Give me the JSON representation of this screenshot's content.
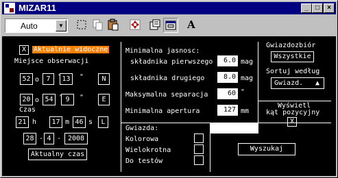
{
  "window": {
    "title": "MIZAR11"
  },
  "titlebar_buttons": {
    "minimize": "_",
    "maximize": "□",
    "close": "×"
  },
  "toolbar": {
    "zoom_value": "Auto",
    "text_tool": "A"
  },
  "observation": {
    "current_checkbox_mark": "X",
    "current_label": "Aktualnie widoczne",
    "place_label": "Miejsce obserwacji",
    "lat": {
      "deg": "52",
      "deg_unit": "o",
      "min": "7",
      "min_unit": "'",
      "sec": "13",
      "sec_unit": "\"",
      "hemisphere": "N"
    },
    "lon": {
      "deg": "20",
      "deg_unit": "o",
      "min": "54",
      "min_unit": "'",
      "sec": "9",
      "sec_unit": "\"",
      "hemisphere": "E"
    },
    "time_label": "Czas",
    "time": {
      "h": "21",
      "h_unit": "h",
      "m": "17",
      "m_unit": "m",
      "s": "46",
      "s_unit": "s",
      "zone": "L"
    },
    "date": {
      "day": "28",
      "sep1": "-",
      "month": "4",
      "sep2": "-",
      "year": "2008"
    },
    "current_time_button": "Aktualny czas"
  },
  "limits": {
    "min_brightness_label": "Minimalna jasnosc:",
    "first_component_label": "składnika pierwszego",
    "first_component_value": "6.0",
    "first_component_unit": "mag",
    "second_component_label": "składnika drugiego",
    "second_component_value": "8.0",
    "second_component_unit": "mag",
    "max_separation_label": "Maksymalna separacja",
    "max_separation_value": "60",
    "max_separation_unit": "\"",
    "min_aperture_label": "Minimalna apertura",
    "min_aperture_value": "127",
    "min_aperture_unit": "mm"
  },
  "star": {
    "section_label": "Gwiazda:",
    "colored_label": "Kolorowa",
    "multiple_label": "Wielokrotna",
    "test_label": "Do testów"
  },
  "search_button": "Wyszukaj",
  "catalog": {
    "label": "Gwiazdozbiór",
    "value": "Wszystkie",
    "sort_label": "Sortuj według",
    "sort_value": "Gwiazd.",
    "sort_arrow": "▲",
    "show_pa_line1": "Wyświetl",
    "show_pa_line2": "kąt pozycyjny",
    "show_pa_mark": "X"
  }
}
